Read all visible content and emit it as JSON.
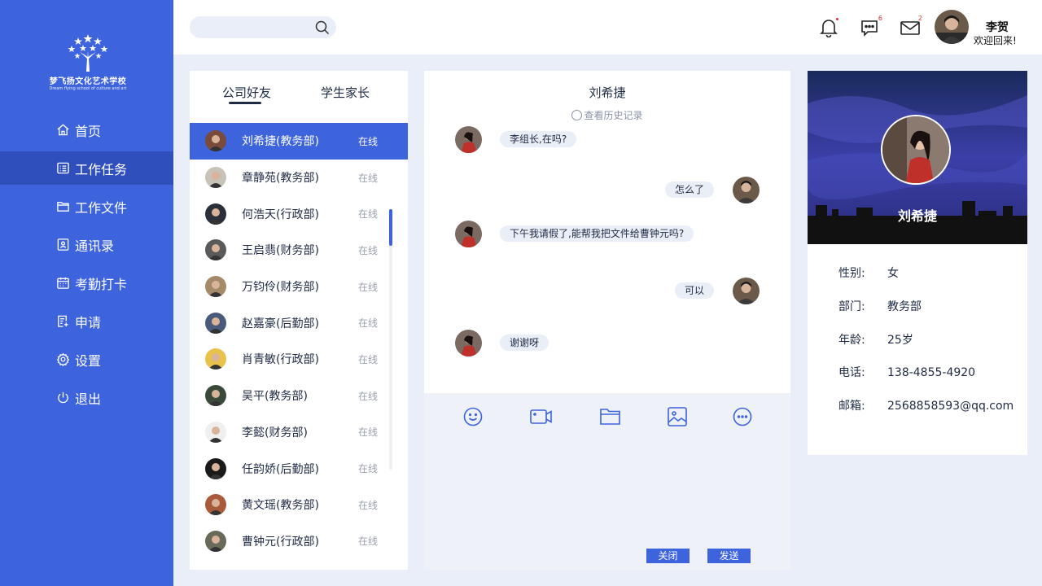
{
  "logo": {
    "title": "梦飞扬文化艺术学校",
    "subtitle": "Dream flying school of culture and art"
  },
  "nav": [
    {
      "label": "首页",
      "icon": "home-icon"
    },
    {
      "label": "工作任务",
      "icon": "task-list-icon",
      "active": true
    },
    {
      "label": "工作文件",
      "icon": "folder-icon"
    },
    {
      "label": "通讯录",
      "icon": "contacts-icon"
    },
    {
      "label": "考勤打卡",
      "icon": "calendar-icon"
    },
    {
      "label": "申请",
      "icon": "application-icon"
    },
    {
      "label": "设置",
      "icon": "gear-icon"
    },
    {
      "label": "退出",
      "icon": "power-icon"
    }
  ],
  "header": {
    "search_placeholder": "",
    "bell_badge": "",
    "message_badge": "6",
    "mail_badge": "2",
    "user_name": "李贺",
    "welcome": "欢迎回来!"
  },
  "contacts": {
    "tabs": [
      "公司好友",
      "学生家长"
    ],
    "list": [
      {
        "name": "刘希捷(教务部)",
        "status": "在线"
      },
      {
        "name": "章静苑(教务部)",
        "status": "在线"
      },
      {
        "name": "何浩天(行政部)",
        "status": "在线"
      },
      {
        "name": "王启翡(财务部)",
        "status": "在线"
      },
      {
        "name": "万钧伶(财务部)",
        "status": "在线"
      },
      {
        "name": "赵嘉豪(后勤部)",
        "status": "在线"
      },
      {
        "name": "肖青敏(行政部)",
        "status": "在线"
      },
      {
        "name": "吴平(教务部)",
        "status": "在线"
      },
      {
        "name": "李懿(财务部)",
        "status": "在线"
      },
      {
        "name": "任韵娇(后勤部)",
        "status": "在线"
      },
      {
        "name": "黄文瑶(教务部)",
        "status": "在线"
      },
      {
        "name": "曹钟元(行政部)",
        "status": "在线"
      }
    ]
  },
  "chat": {
    "title": "刘希捷",
    "history": "查看历史记录",
    "messages": [
      {
        "text": "李组长,在吗?",
        "side": "left"
      },
      {
        "text": "怎么了",
        "side": "right"
      },
      {
        "text": "下午我请假了,能帮我把文件给曹钟元吗?",
        "side": "left"
      },
      {
        "text": "可以",
        "side": "right"
      },
      {
        "text": "谢谢呀",
        "side": "left"
      }
    ],
    "close_label": "关闭",
    "send_label": "发送"
  },
  "profile": {
    "name": "刘希捷",
    "fields": [
      {
        "label": "性别:",
        "value": "女"
      },
      {
        "label": "部门:",
        "value": "教务部"
      },
      {
        "label": "年龄:",
        "value": "25岁"
      },
      {
        "label": "电话:",
        "value": "138-4855-4920"
      },
      {
        "label": "邮箱:",
        "value": "2568858593@qq.com"
      }
    ]
  },
  "colors": {
    "accent": "#3d63dd",
    "sidebar_active": "#2f4fbd",
    "background": "#eaeef9"
  }
}
